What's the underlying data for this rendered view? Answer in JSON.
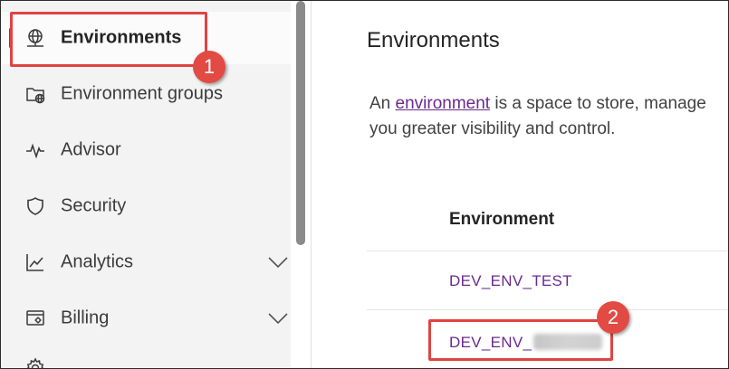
{
  "sidebar": {
    "items": [
      {
        "label": "Environments",
        "icon": "globe-icon"
      },
      {
        "label": "Environment groups",
        "icon": "folder-globe-icon"
      },
      {
        "label": "Advisor",
        "icon": "pulse-icon"
      },
      {
        "label": "Security",
        "icon": "shield-icon"
      },
      {
        "label": "Analytics",
        "icon": "line-chart-icon"
      },
      {
        "label": "Billing",
        "icon": "billing-settings-icon"
      }
    ]
  },
  "main": {
    "title": "Environments",
    "description": {
      "prefix": "An ",
      "link": "environment",
      "suffix": " is a space to store, manage",
      "line2": "you greater visibility and control."
    },
    "table": {
      "column_header": "Environment",
      "rows": [
        "DEV_ENV_TEST",
        "DEV_ENV_"
      ]
    }
  },
  "annotations": {
    "step1": "1",
    "step2": "2"
  },
  "colors": {
    "accent": "#6a2a8e",
    "highlight": "#e04343",
    "sidebar_bg": "#f3f3f3"
  }
}
